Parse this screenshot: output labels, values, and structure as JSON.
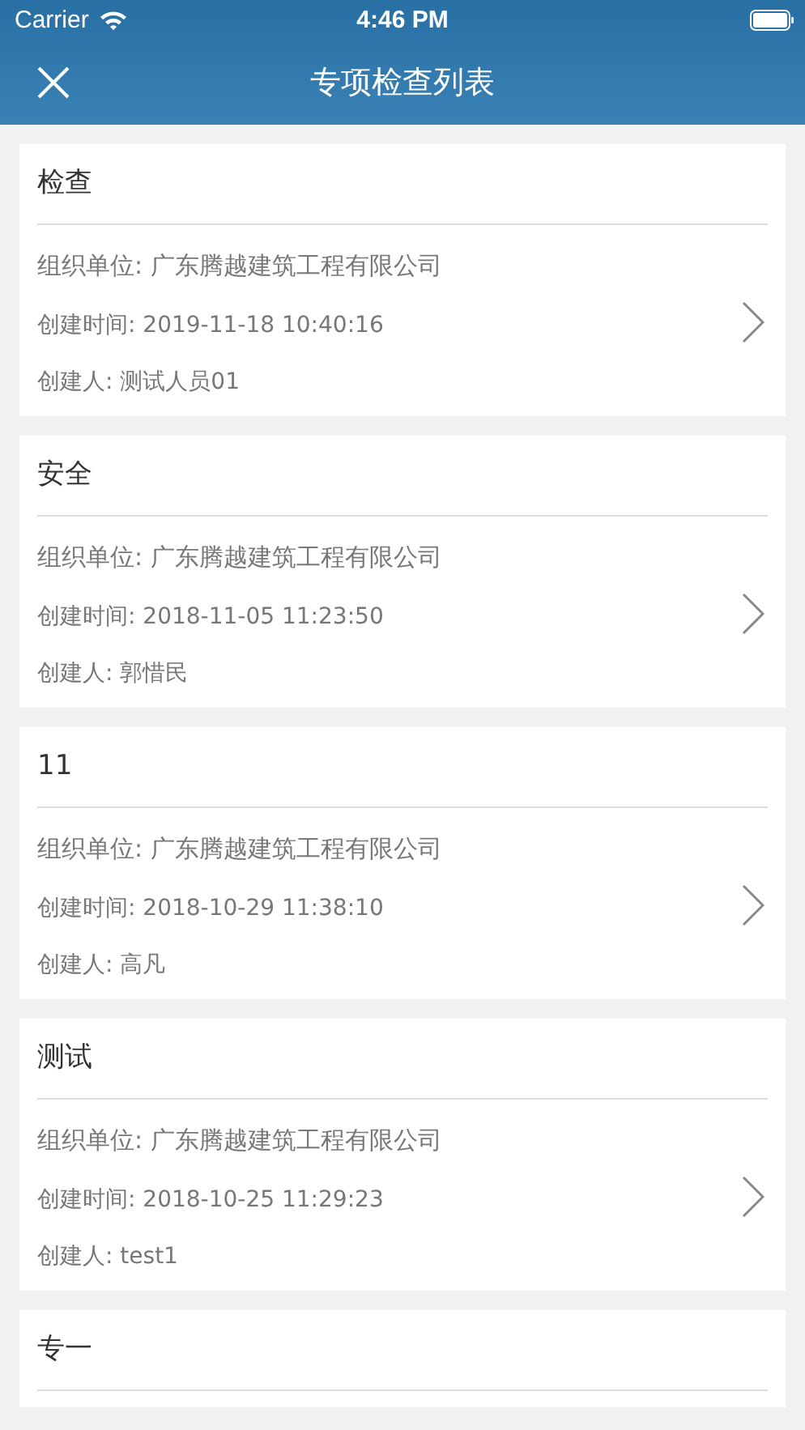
{
  "status_bar": {
    "carrier": "Carrier",
    "time": "4:46 PM"
  },
  "nav": {
    "title": "专项检查列表"
  },
  "cards": [
    {
      "title": "检查",
      "org": "组织单位: 广东腾越建筑工程有限公司",
      "created": "创建时间: 2019-11-18 10:40:16",
      "creator": "创建人: 测试人员01"
    },
    {
      "title": "安全",
      "org": "组织单位: 广东腾越建筑工程有限公司",
      "created": "创建时间: 2018-11-05 11:23:50",
      "creator": "创建人: 郭惜民"
    },
    {
      "title": "11",
      "org": "组织单位: 广东腾越建筑工程有限公司",
      "created": "创建时间: 2018-10-29 11:38:10",
      "creator": "创建人: 高凡"
    },
    {
      "title": "测试",
      "org": "组织单位: 广东腾越建筑工程有限公司",
      "created": "创建时间: 2018-10-25 11:29:23",
      "creator": "创建人: test1"
    },
    {
      "title": "专一"
    }
  ]
}
